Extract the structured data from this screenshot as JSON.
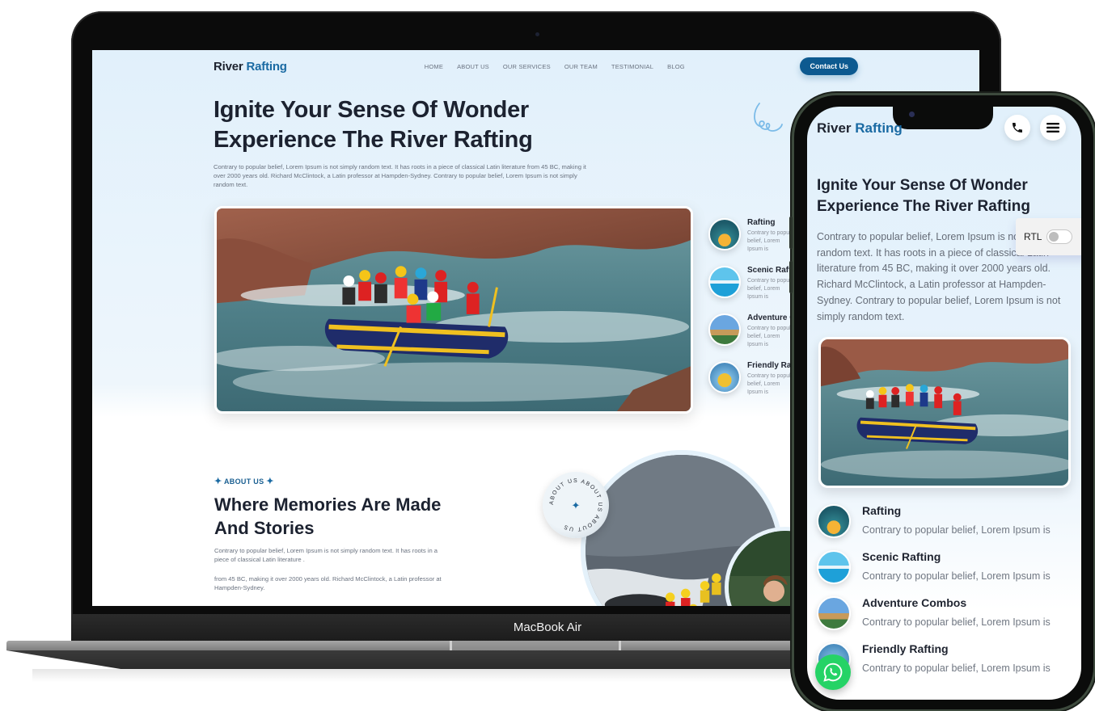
{
  "laptop": {
    "brand_label": "MacBook Air",
    "site": {
      "logo": {
        "primary": "River",
        "accent": "Rafting"
      },
      "nav_items": [
        "HOME",
        "ABOUT US",
        "OUR SERVICES",
        "OUR TEAM",
        "TESTIMONIAL",
        "BLOG"
      ],
      "contact_button": "Contact Us",
      "hero": {
        "title_line1": "Ignite Your Sense Of Wonder",
        "title_line2": "Experience The River Rafting",
        "description": "Contrary to popular belief, Lorem Ipsum is not simply random text. It has roots in a piece of classical Latin literature from 45 BC, making it over 2000 years old. Richard McClintock, a Latin professor at Hampden-Sydney. Contrary to popular belief, Lorem Ipsum is not simply random text."
      },
      "services": [
        {
          "title": "Rafting",
          "desc": "Contrary to popular belief, Lorem Ipsum is"
        },
        {
          "title": "Scenic Rafting",
          "desc": "Contrary to popular belief, Lorem Ipsum is"
        },
        {
          "title": "Adventure Combos",
          "desc": "Contrary to popular belief, Lorem Ipsum is"
        },
        {
          "title": "Friendly Rafting",
          "desc": "Contrary to popular belief, Lorem Ipsum is"
        }
      ],
      "about": {
        "tag": "ABOUT US",
        "title_line1": "Where Memories Are Made",
        "title_line2": "And Stories",
        "para1": "Contrary to popular belief, Lorem Ipsum is not simply random text. It has roots in a piece of classical Latin literature .",
        "para2": "from 45 BC, making it over 2000 years old. Richard McClintock, a Latin professor at Hampden-Sydney.",
        "badge_text": "ABOUT US ABOUT US ABOUT US "
      }
    }
  },
  "phone": {
    "logo": {
      "primary": "River",
      "accent": "Rafting"
    },
    "header_icons": [
      "phone-icon",
      "menu-icon"
    ],
    "hero": {
      "title_line1": "Ignite Your Sense Of Wonder",
      "title_line2": "Experience The River Rafting",
      "description": "Contrary to popular belief, Lorem Ipsum is not simply random text. It has roots in a piece of classical Latin literature from 45 BC, making it over 2000 years old. Richard McClintock, a Latin professor at Hampden-Sydney. Contrary to popular belief, Lorem Ipsum is not simply random text."
    },
    "rtl_toggle": {
      "label": "RTL",
      "enabled": false
    },
    "services": [
      {
        "title": "Rafting",
        "desc": "Contrary to popular belief, Lorem Ipsum is"
      },
      {
        "title": "Scenic Rafting",
        "desc": "Contrary to popular belief, Lorem Ipsum is"
      },
      {
        "title": "Adventure Combos",
        "desc": "Contrary to popular belief, Lorem Ipsum is"
      },
      {
        "title": "Friendly Rafting",
        "desc": "Contrary to popular belief, Lorem Ipsum is"
      }
    ],
    "floating_button": "whatsapp-icon"
  },
  "colors": {
    "brand_blue": "#1a6aa3",
    "button_blue": "#0d5a90",
    "heading": "#1c2230",
    "body_text": "#6b7380",
    "hero_bg": "#e1f0fb",
    "whatsapp_green": "#25d366"
  }
}
